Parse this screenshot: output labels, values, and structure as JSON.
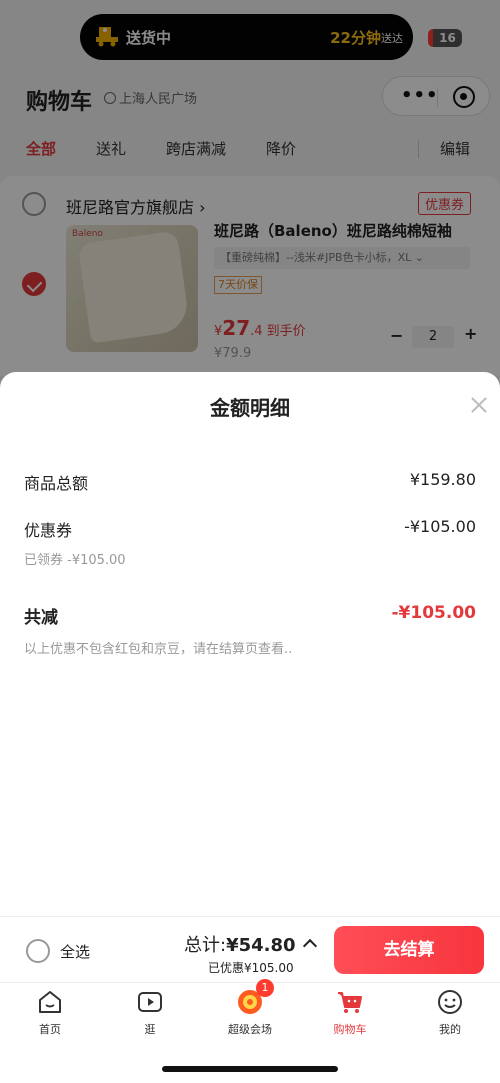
{
  "status_bar": {
    "delivery_status": "送货中",
    "eta": "22分钟",
    "eta_suffix": "送达",
    "battery": "16"
  },
  "header": {
    "title": "购物车",
    "location": "上海人民广场"
  },
  "tabs": [
    {
      "label": "全部",
      "active": true
    },
    {
      "label": "送礼",
      "active": false
    },
    {
      "label": "跨店满减",
      "active": false
    },
    {
      "label": "降价",
      "active": false
    },
    {
      "label": "编辑",
      "active": false
    }
  ],
  "store": {
    "name": "班尼路官方旗舰店",
    "coupon_label": "优惠券",
    "product": {
      "brand": "Baleno",
      "title": "班尼路（Baleno）班尼路纯棉短袖",
      "sku": "【重磅纯棉】--浅米#JPB色卡小标，XL",
      "price_guard": "7天价保",
      "price_symbol": "¥",
      "price_main": "27",
      "price_decimal": ".4",
      "price_suffix": "到手价",
      "original_price": "¥79.9",
      "quantity": "2",
      "checked": true
    }
  },
  "sheet": {
    "title": "金额明细",
    "rows": [
      {
        "label": "商品总额",
        "value": "¥159.80"
      },
      {
        "label": "优惠券",
        "value": "-¥105.00",
        "sub": "已领券 -¥105.00"
      }
    ],
    "total_label": "共减",
    "total_value": "-¥105.00",
    "note": "以上优惠不包含红包和京豆，请在结算页查看.."
  },
  "checkout": {
    "select_all": "全选",
    "total_label": "总计:",
    "total_amount": "¥54.80",
    "discount": "已优惠¥105.00",
    "button": "去结算"
  },
  "nav": [
    {
      "label": "首页",
      "icon": "home-icon"
    },
    {
      "label": "逛",
      "icon": "video-icon"
    },
    {
      "label": "超级会场",
      "icon": "venue-icon",
      "badge": "1"
    },
    {
      "label": "购物车",
      "icon": "cart-icon",
      "active": true
    },
    {
      "label": "我的",
      "icon": "profile-icon"
    }
  ],
  "colors": {
    "accent": "#e4393c",
    "eta": "#ffc21a"
  }
}
